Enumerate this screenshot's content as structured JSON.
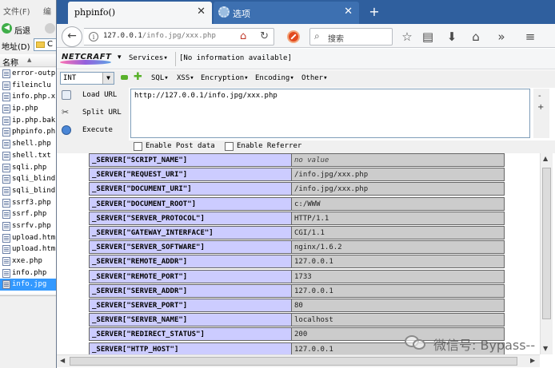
{
  "explorer": {
    "menu": [
      "文件(F)",
      "编"
    ],
    "back_label": "后退",
    "address_label": "地址(D)",
    "address_value": "C",
    "column_header": "名称",
    "files": [
      "error-outp",
      "fileinclu",
      "info.php.x",
      "ip.php",
      "ip.php.bak",
      "phpinfo.ph",
      "shell.php",
      "shell.txt",
      "sqli.php",
      "sqli_blind",
      "sqli_blind",
      "ssrf3.php",
      "ssrf.php",
      "ssrfv.php",
      "upload.htm",
      "upload.htm",
      "xxe.php",
      "info.php",
      "info.jpg"
    ],
    "selected_index": 18
  },
  "tabs": [
    {
      "title": "phpinfo()",
      "close": "✕"
    },
    {
      "title": "选项",
      "close": "✕"
    }
  ],
  "newtab": "+",
  "nav": {
    "back": "←",
    "url_host": "127.0.0.1",
    "url_path": "/info.jpg/xxx.php",
    "search_placeholder": "搜索"
  },
  "netcraft": {
    "brand": "NETCRAFT",
    "services": "Services▾",
    "info": "[No information available]"
  },
  "hackbar": {
    "select_value": "INT",
    "menus": [
      "SQL▾",
      "XSS▾",
      "Encryption▾",
      "Encoding▾",
      "Other▾"
    ],
    "actions": [
      "Load URL",
      "Split URL",
      "Execute"
    ],
    "url_value": "http://127.0.0.1/info.jpg/xxx.php",
    "checkbox_post": "Enable Post data",
    "checkbox_referrer": "Enable Referrer"
  },
  "server_table": [
    {
      "key": "_SERVER[\"SCRIPT_NAME\"]",
      "value": "no value"
    },
    {
      "key": "_SERVER[\"REQUEST_URI\"]",
      "value": "/info.jpg/xxx.php"
    },
    {
      "key": "_SERVER[\"DOCUMENT_URI\"]",
      "value": "/info.jpg/xxx.php"
    },
    {
      "key": "_SERVER[\"DOCUMENT_ROOT\"]",
      "value": "c:/WWW"
    },
    {
      "key": "_SERVER[\"SERVER_PROTOCOL\"]",
      "value": "HTTP/1.1"
    },
    {
      "key": "_SERVER[\"GATEWAY_INTERFACE\"]",
      "value": "CGI/1.1"
    },
    {
      "key": "_SERVER[\"SERVER_SOFTWARE\"]",
      "value": "nginx/1.6.2"
    },
    {
      "key": "_SERVER[\"REMOTE_ADDR\"]",
      "value": "127.0.0.1"
    },
    {
      "key": "_SERVER[\"REMOTE_PORT\"]",
      "value": "1733"
    },
    {
      "key": "_SERVER[\"SERVER_ADDR\"]",
      "value": "127.0.0.1"
    },
    {
      "key": "_SERVER[\"SERVER_PORT\"]",
      "value": "80"
    },
    {
      "key": "_SERVER[\"SERVER_NAME\"]",
      "value": "localhost"
    },
    {
      "key": "_SERVER[\"REDIRECT_STATUS\"]",
      "value": "200"
    },
    {
      "key": "_SERVER[\"HTTP_HOST\"]",
      "value": "127.0.0.1"
    }
  ],
  "watermark": "微信号: Bypass--",
  "colors": {
    "tabbar": "#2f5f9e",
    "key_cell": "#ccccff",
    "value_cell": "#cccccc",
    "selection": "#3399ff"
  }
}
